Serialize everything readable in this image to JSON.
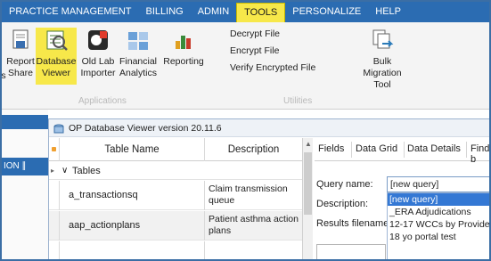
{
  "tabs": [
    {
      "label": "PRACTICE MANAGEMENT"
    },
    {
      "label": "BILLING"
    },
    {
      "label": "ADMIN"
    },
    {
      "label": "TOOLS"
    },
    {
      "label": "PERSONALIZE"
    },
    {
      "label": "HELP"
    }
  ],
  "ribbon": {
    "left_partial": "s",
    "report_share": "Report Share",
    "database_viewer": "Database Viewer",
    "old_lab_importer": "Old Lab Importer",
    "financial_analytics": "Financial Analytics",
    "reporting": "Reporting",
    "decrypt_file": "Decrypt File",
    "encrypt_file": "Encrypt File",
    "verify_encrypted_file": "Verify Encrypted File",
    "bulk_migration_tool": "Bulk Migration Tool",
    "group_applications": "Applications",
    "group_utilities": "Utilities"
  },
  "left_nav": {
    "label": "ION ∥"
  },
  "db_viewer": {
    "title": "OP Database Viewer  version 20.11.6",
    "columns": {
      "table_name": "Table Name",
      "description": "Description"
    },
    "group_label": "Tables",
    "rows": [
      {
        "name": "a_transactionsq",
        "description": "Claim transmission queue"
      },
      {
        "name": "aap_actionplans",
        "description": "Patient asthma action plans"
      }
    ],
    "right_tabs": {
      "fields": "Fields",
      "data_grid": "Data Grid",
      "data_details": "Data Details",
      "find": "Find b"
    },
    "query_name_label": "Query name:",
    "query_name_value": "[new query]",
    "description_label": "Description:",
    "results_filename_label": "Results filename:",
    "dropdown_options": [
      "[new query]",
      "_ERA Adjudications",
      "12-17 WCCs by Provide",
      "18 yo portal test"
    ]
  },
  "colors": {
    "ribbon_blue": "#2b6cb2",
    "tools_highlight": "#f7e84a",
    "selected_option": "#3478d4"
  }
}
